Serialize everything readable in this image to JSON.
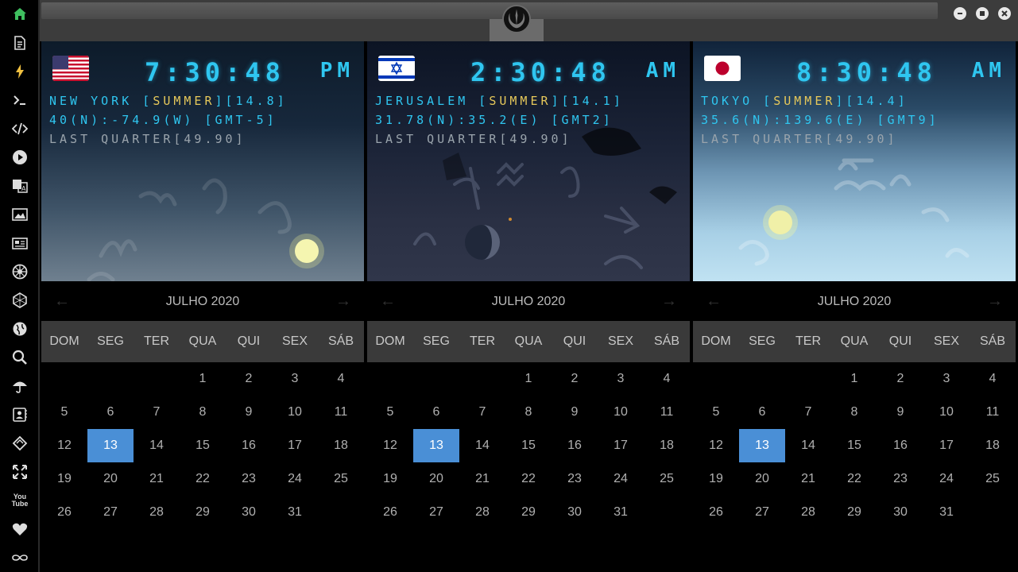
{
  "sidebar": {
    "items": [
      {
        "icon": "home-icon",
        "color": "#3fbf5f"
      },
      {
        "icon": "document-icon"
      },
      {
        "icon": "lightning-icon",
        "color": "#f0c040"
      },
      {
        "icon": "terminal-icon"
      },
      {
        "icon": "code-icon"
      },
      {
        "icon": "play-icon"
      },
      {
        "icon": "translate-icon"
      },
      {
        "icon": "image-icon"
      },
      {
        "icon": "news-icon"
      },
      {
        "icon": "galactic-empire-icon"
      },
      {
        "icon": "hexagon-icon"
      },
      {
        "icon": "globe-icon"
      },
      {
        "icon": "search-icon"
      },
      {
        "icon": "umbrella-icon"
      },
      {
        "icon": "contact-card-icon"
      },
      {
        "icon": "tag-icon"
      },
      {
        "icon": "fullscreen-icon"
      },
      {
        "icon": "youtube-icon",
        "label": "You Tube"
      },
      {
        "icon": "heart-icon"
      },
      {
        "icon": "infinity-cloud-icon"
      }
    ]
  },
  "window": {
    "logo": "rebel-alliance-icon",
    "controls": [
      "minimize",
      "maximize",
      "close"
    ]
  },
  "panels": [
    {
      "flag": "us",
      "time": "7:30:48",
      "ampm": "PM",
      "city_prefix": "NEW YORK [",
      "season": "SUMMER",
      "city_suffix": "][14.8]",
      "coords": "40(N):-74.9(W) [GMT-5]",
      "moon": "LAST QUARTER[49.90]",
      "month_title": "JULHO 2020"
    },
    {
      "flag": "il",
      "time": "2:30:48",
      "ampm": "AM",
      "city_prefix": "JERUSALEM [",
      "season": "SUMMER",
      "city_suffix": "][14.1]",
      "coords": "31.78(N):35.2(E) [GMT2]",
      "moon": "LAST QUARTER[49.90]",
      "month_title": "JULHO 2020"
    },
    {
      "flag": "jp",
      "time": "8:30:48",
      "ampm": "AM",
      "city_prefix": "TOKYO [",
      "season": "SUMMER",
      "city_suffix": "][14.4]",
      "coords": "35.6(N):139.6(E) [GMT9]",
      "moon": "LAST QUARTER[49.90]",
      "month_title": "JULHO 2020"
    }
  ],
  "calendar": {
    "weekdays": [
      "DOM",
      "SEG",
      "TER",
      "QUA",
      "QUI",
      "SEX",
      "SÁB"
    ],
    "weeks": [
      [
        "",
        "",
        "",
        "1",
        "2",
        "3",
        "4"
      ],
      [
        "5",
        "6",
        "7",
        "8",
        "9",
        "10",
        "11"
      ],
      [
        "12",
        "13",
        "14",
        "15",
        "16",
        "17",
        "18"
      ],
      [
        "19",
        "20",
        "21",
        "22",
        "23",
        "24",
        "25"
      ],
      [
        "26",
        "27",
        "28",
        "29",
        "30",
        "31",
        ""
      ]
    ],
    "today": "13",
    "prev_arrow": "←",
    "next_arrow": "→"
  },
  "colors": {
    "lcd": "#2fc6f0",
    "season": "#e6c85a",
    "today": "#4a8fd6"
  }
}
